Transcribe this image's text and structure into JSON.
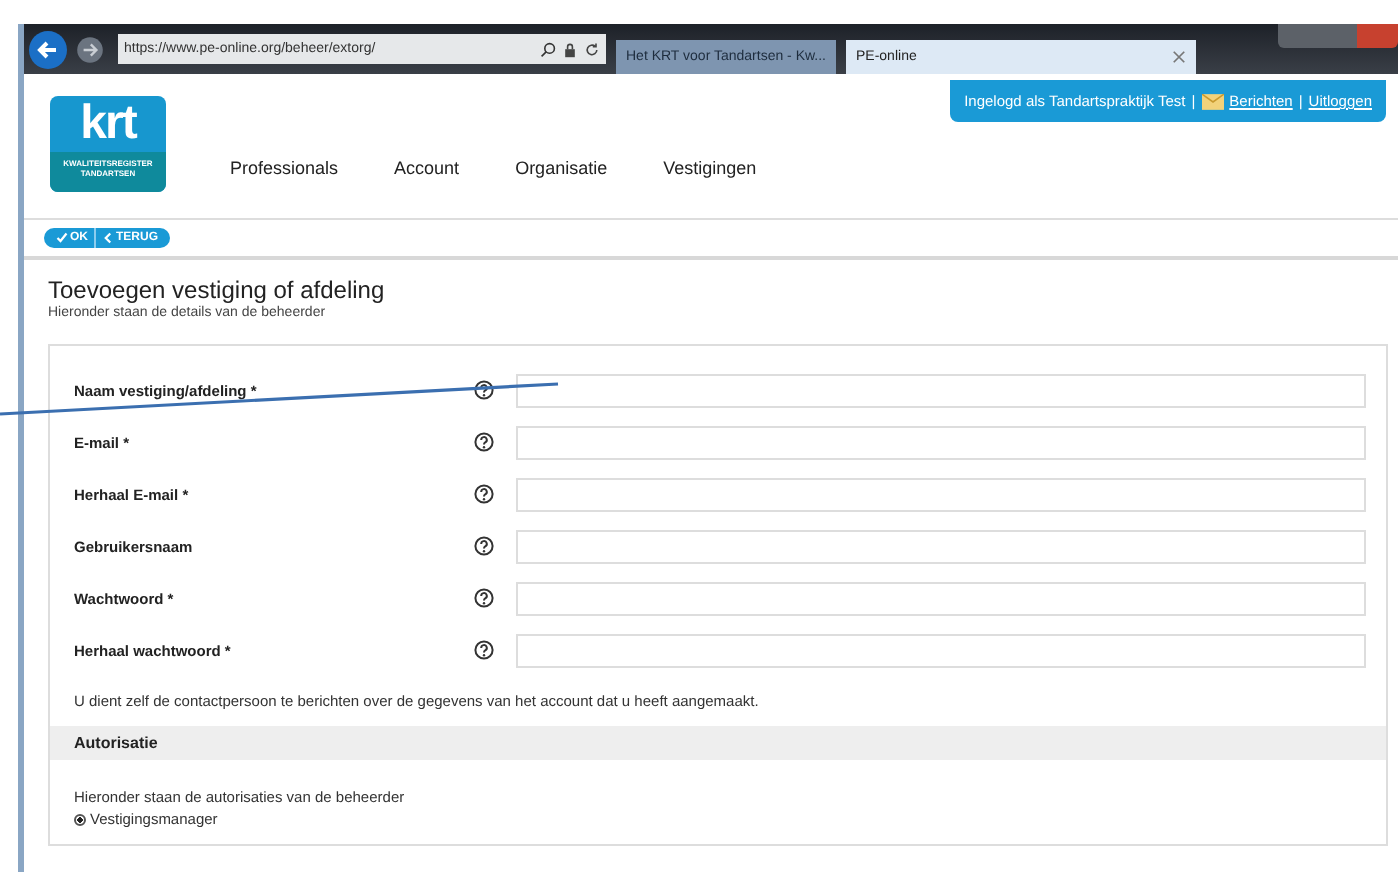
{
  "browser": {
    "address": "https://www.pe-online.org/beheer/extorg/",
    "tabs": [
      {
        "title": "Het KRT voor Tandartsen - Kw...",
        "selected": false
      },
      {
        "title": "PE-online",
        "selected": true
      }
    ]
  },
  "header": {
    "logo": {
      "mark": "krt",
      "subtitle": "KWALITEITSREGISTER TANDARTSEN"
    },
    "nav": [
      "Professionals",
      "Account",
      "Organisatie",
      "Vestigingen"
    ],
    "login": {
      "text": "Ingelogd als Tandartspraktijk Test",
      "separators": [
        "|",
        "|"
      ],
      "links": [
        "Berichten",
        "Uitloggen"
      ]
    }
  },
  "toolbar": {
    "buttons": [
      {
        "kind": "ok",
        "label": "OK"
      },
      {
        "kind": "back",
        "label": "TERUG"
      }
    ]
  },
  "page": {
    "title": "Toevoegen vestiging of afdeling",
    "subtitle": "Hieronder staan de details van de beheerder",
    "fields": [
      {
        "label": "Naam vestiging/afdeling *"
      },
      {
        "label": "E-mail *"
      },
      {
        "label": "Herhaal E-mail *"
      },
      {
        "label": "Gebruikersnaam"
      },
      {
        "label": "Wachtwoord *"
      },
      {
        "label": "Herhaal wachtwoord *"
      }
    ],
    "note": "U dient zelf de contactpersoon te berichten over de gegevens van het account dat u heeft aangemaakt.",
    "section": {
      "title": "Autorisatie",
      "subtitle": "Hieronder staan de autorisaties van de beheerder",
      "options": [
        {
          "label": "Vestigingsmanager",
          "selected": true
        }
      ]
    }
  }
}
